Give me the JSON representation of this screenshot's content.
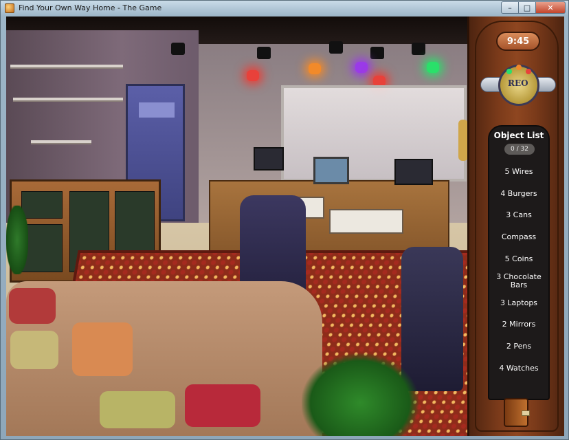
{
  "window": {
    "title": "Find Your Own Way Home - The Game",
    "min_glyph": "–",
    "max_glyph": "□",
    "close_glyph": "✕"
  },
  "hud": {
    "timer": "9:45",
    "logo_text": "REO"
  },
  "object_list": {
    "title": "Object List",
    "count": "0 / 32",
    "items": [
      {
        "label": "5 Wires"
      },
      {
        "label": "4 Burgers"
      },
      {
        "label": "3 Cans"
      },
      {
        "label": "Compass"
      },
      {
        "label": "5 Coins"
      },
      {
        "label": "3 Chocolate Bars"
      },
      {
        "label": "3 Laptops"
      },
      {
        "label": "2 Mirrors"
      },
      {
        "label": "2 Pens"
      },
      {
        "label": "4 Watches"
      }
    ]
  },
  "colors": {
    "panel_wood": "#7a3a1a",
    "timer_orange": "#c06a3a",
    "list_bg": "#1d1a1a",
    "light_red": "#e8413a",
    "light_orange": "#f28a2a",
    "light_purple": "#9a3ae8",
    "light_green": "#2ae06a"
  },
  "icons": {
    "journal": "journal-icon",
    "app": "app-icon"
  }
}
